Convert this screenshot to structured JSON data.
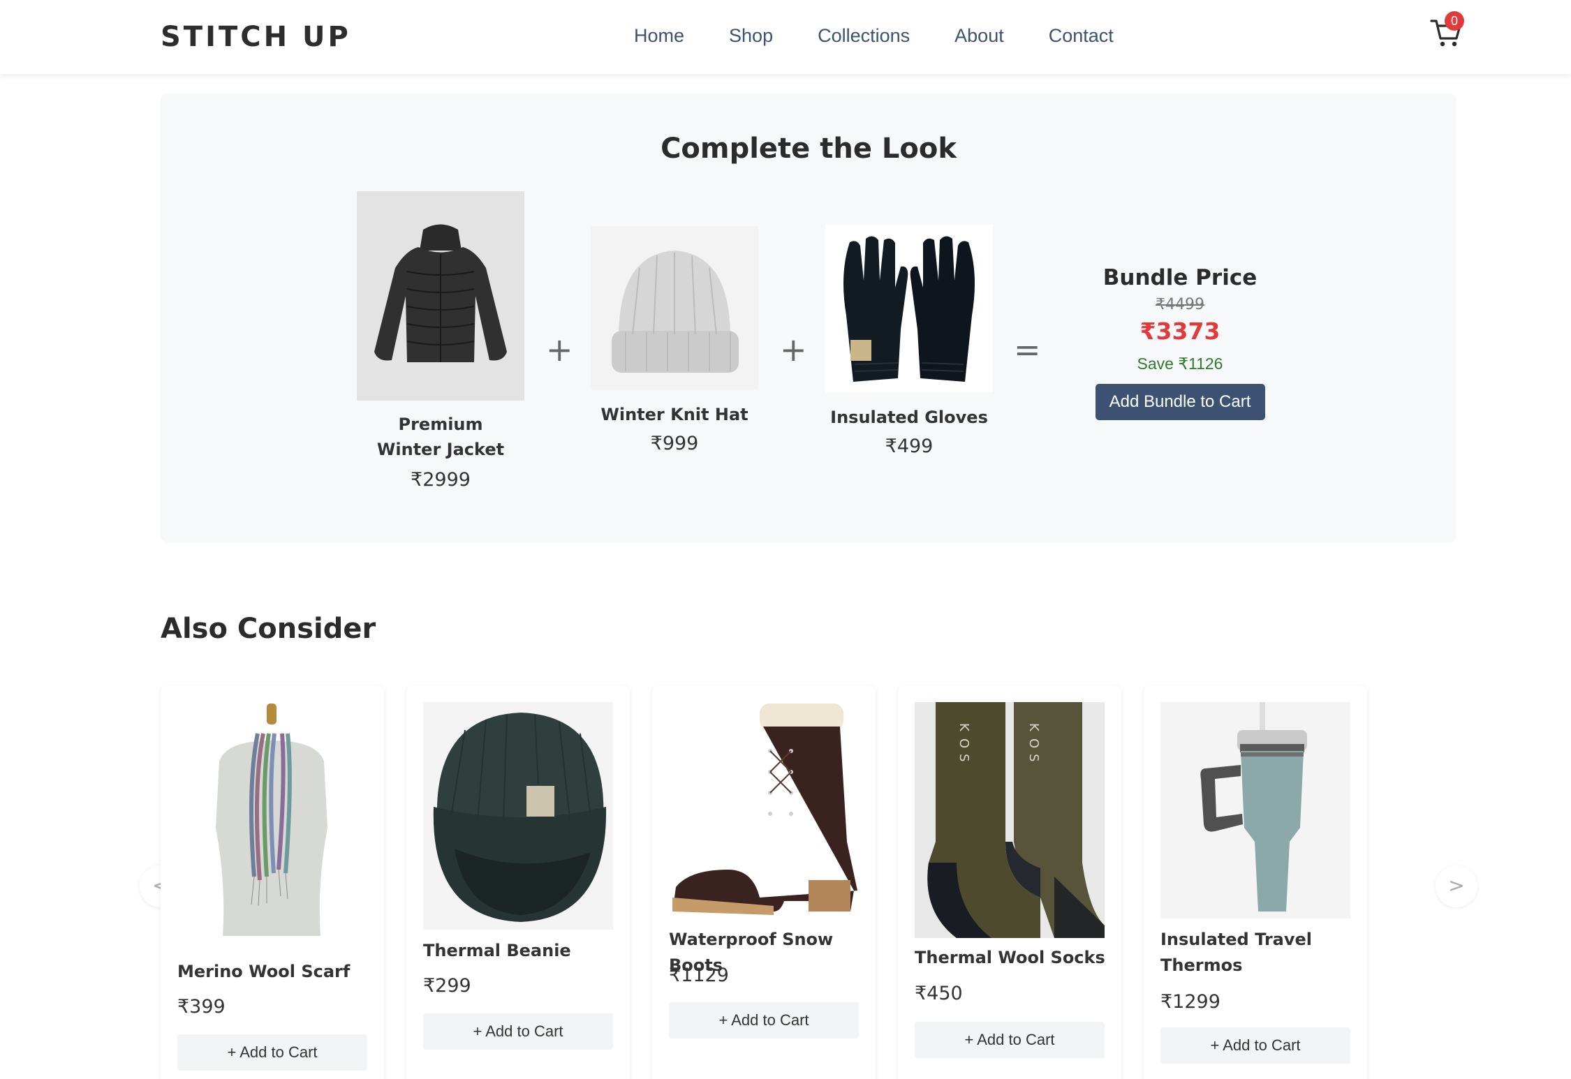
{
  "header": {
    "brand": "STITCH UP",
    "nav": [
      "Home",
      "Shop",
      "Collections",
      "About",
      "Contact"
    ],
    "cart_count": "0",
    "cart_icon": "cart-icon"
  },
  "bundle": {
    "title": "Complete the Look",
    "items": [
      {
        "name": "Premium Winter Jacket",
        "price": "₹2999"
      },
      {
        "name": "Winter Knit Hat",
        "price": "₹999"
      },
      {
        "name": "Insulated Gloves",
        "price": "₹499"
      }
    ],
    "plus": "+",
    "equals": "=",
    "price_label": "Bundle Price",
    "original_price": "₹4499",
    "sale_price": "₹3373",
    "savings": "Save ₹1126",
    "button_label": "Add Bundle to Cart"
  },
  "also_consider": {
    "title": "Also Consider",
    "prev_label": "<",
    "next_label": ">",
    "products": [
      {
        "name": "Merino Wool Scarf",
        "price": "₹399",
        "button": "+ Add to Cart"
      },
      {
        "name": "Thermal Beanie",
        "price": "₹299",
        "button": "+ Add to Cart"
      },
      {
        "name": "Waterproof Snow Boots",
        "price": "₹1129",
        "button": "+ Add to Cart"
      },
      {
        "name": "Thermal Wool Socks",
        "price": "₹450",
        "button": "+ Add to Cart"
      },
      {
        "name": "Insulated Travel Thermos",
        "price": "₹1299",
        "button": "+ Add to Cart"
      }
    ]
  },
  "colors": {
    "accent": "#3d5172",
    "sale": "#e03a3a",
    "savings": "#2f7a2f",
    "panel": "#f7f8f9"
  }
}
